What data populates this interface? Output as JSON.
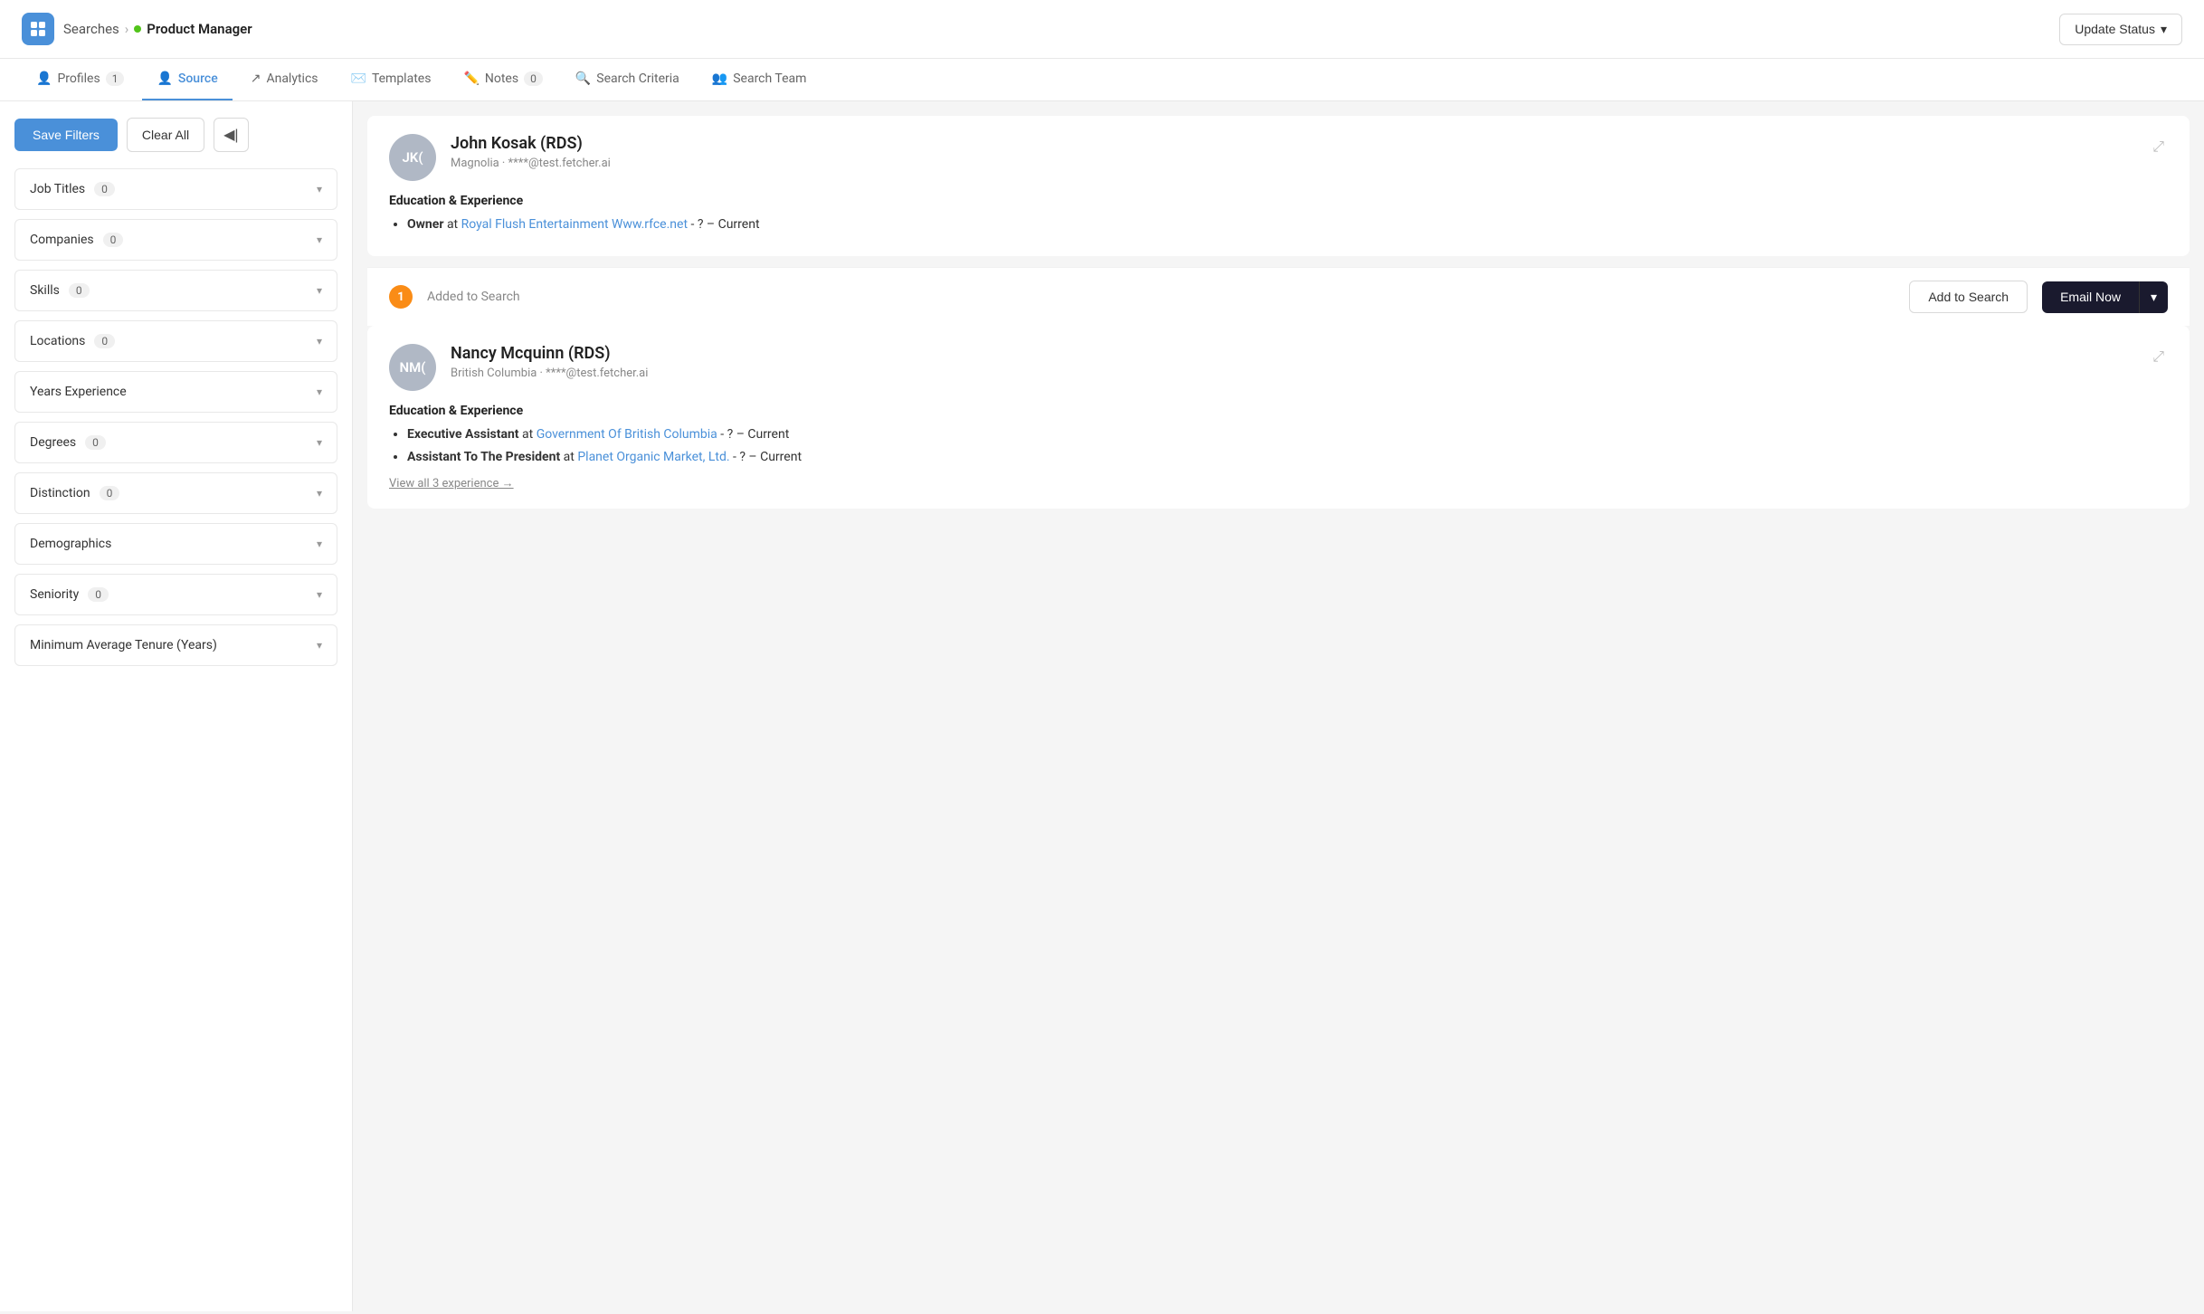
{
  "topbar": {
    "logo_alt": "Fetcher Logo",
    "breadcrumb_parent": "Searches",
    "breadcrumb_sep": ">",
    "status_label": "Product Manager",
    "update_status_label": "Update Status"
  },
  "tabs": [
    {
      "id": "profiles",
      "label": "Profiles",
      "badge": "1",
      "icon": "👤",
      "active": false
    },
    {
      "id": "source",
      "label": "Source",
      "badge": "",
      "icon": "👤",
      "active": true
    },
    {
      "id": "analytics",
      "label": "Analytics",
      "badge": "",
      "icon": "📈",
      "active": false
    },
    {
      "id": "templates",
      "label": "Templates",
      "badge": "",
      "icon": "✉️",
      "active": false
    },
    {
      "id": "notes",
      "label": "Notes",
      "badge": "0",
      "icon": "✏️",
      "active": false
    },
    {
      "id": "search-criteria",
      "label": "Search Criteria",
      "badge": "",
      "icon": "🔍",
      "active": false
    },
    {
      "id": "search-team",
      "label": "Search Team",
      "badge": "",
      "icon": "👥",
      "active": false
    }
  ],
  "sidebar": {
    "save_filters_label": "Save Filters",
    "clear_all_label": "Clear All",
    "collapse_icon": "◀",
    "filters": [
      {
        "id": "job-titles",
        "label": "Job Titles",
        "count": "0",
        "show_count": true
      },
      {
        "id": "companies",
        "label": "Companies",
        "count": "0",
        "show_count": true
      },
      {
        "id": "skills",
        "label": "Skills",
        "count": "0",
        "show_count": true
      },
      {
        "id": "locations",
        "label": "Locations",
        "count": "0",
        "show_count": true
      },
      {
        "id": "years-experience",
        "label": "Years Experience",
        "count": "",
        "show_count": false
      },
      {
        "id": "degrees",
        "label": "Degrees",
        "count": "0",
        "show_count": true
      },
      {
        "id": "distinction",
        "label": "Distinction",
        "count": "0",
        "show_count": true
      },
      {
        "id": "demographics",
        "label": "Demographics",
        "count": "",
        "show_count": false
      },
      {
        "id": "seniority",
        "label": "Seniority",
        "count": "0",
        "show_count": true
      },
      {
        "id": "minimum-average-tenure",
        "label": "Minimum Average Tenure (Years)",
        "count": "",
        "show_count": false
      }
    ]
  },
  "profiles": [
    {
      "id": "john-kosak",
      "initials": "JK(",
      "avatar_bg": "#b0b8c5",
      "name": "John Kosak (RDS)",
      "company": "Magnolia",
      "email_masked": "****@test.fetcher.ai",
      "edu_exp_title": "Education & Experience",
      "experiences": [
        {
          "role": "Owner",
          "company": "Royal Flush Entertainment Www.rfce.net",
          "company_link": "#",
          "date_range": "? – Current"
        }
      ],
      "view_all": null
    },
    {
      "id": "nancy-mcquinn",
      "initials": "NM(",
      "avatar_bg": "#b0b8c5",
      "name": "Nancy Mcquinn (RDS)",
      "company": "British Columbia",
      "email_masked": "****@test.fetcher.ai",
      "edu_exp_title": "Education & Experience",
      "experiences": [
        {
          "role": "Executive Assistant",
          "company": "Government Of British Columbia",
          "company_link": "#",
          "date_range": "? – Current"
        },
        {
          "role": "Assistant To The President",
          "company": "Planet Organic Market, Ltd.",
          "company_link": "#",
          "date_range": "? – Current"
        }
      ],
      "view_all": "View all 3 experience →"
    }
  ],
  "added_bar": {
    "count": "1",
    "text": "Added to Search",
    "add_to_search_label": "Add to Search",
    "email_now_label": "Email Now",
    "email_now_dropdown_icon": "▾"
  }
}
